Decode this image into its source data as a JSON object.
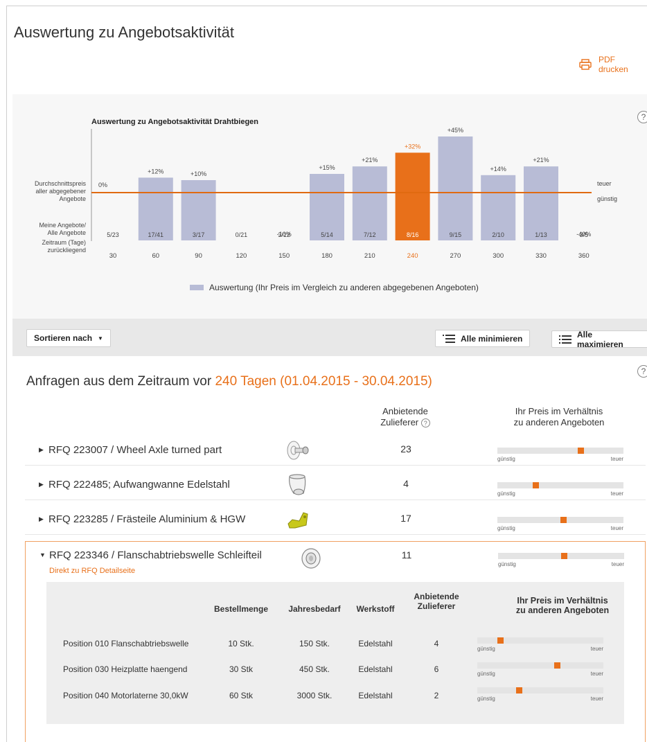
{
  "page": {
    "title": "Auswertung zu Angebotsaktivität",
    "pdf_label": "PDF drucken"
  },
  "chart_help": "?",
  "chart_data": {
    "type": "bar",
    "title": "Auswertung zu Angebotsaktivität Drahtbiegen",
    "categories": [
      "30",
      "60",
      "90",
      "120",
      "150",
      "180",
      "210",
      "240",
      "270",
      "300",
      "330",
      "360"
    ],
    "series": [
      {
        "name": "Auswertung (Ihr Preis im Vergleich zu anderen abgegebenen Angeboten)",
        "values": [
          0,
          12,
          10,
          null,
          -10,
          15,
          21,
          32,
          45,
          14,
          21,
          -40
        ]
      }
    ],
    "value_labels": [
      "0%",
      "+12%",
      "+10%",
      "",
      "-10%",
      "+15%",
      "+21%",
      "+32%",
      "+45%",
      "+14%",
      "+21%",
      "-40%"
    ],
    "offer_ratios": [
      "5/23",
      "17/41",
      "3/17",
      "0/21",
      "3/12",
      "5/14",
      "7/12",
      "8/16",
      "9/15",
      "2/10",
      "1/13",
      "3/5"
    ],
    "highlight_index": 7,
    "reference_line_label": [
      "Durchschnittspreis",
      "aller abgegebener",
      "Angebote"
    ],
    "ratio_row_label": [
      "Meine Angebote/",
      "Alle Angebote"
    ],
    "x_row_label": [
      "Zeitraum (Tage)",
      "zurückliegend"
    ],
    "right_labels": {
      "top": "teuer",
      "bottom": "günstig"
    },
    "colors": {
      "bar": "#b8bcd6",
      "highlight": "#e8701a",
      "line": "#e06a10"
    },
    "legend_placement": "bottom-center"
  },
  "toolbar": {
    "sort_label": "Sortieren nach",
    "minimize_label": "Alle minimieren",
    "maximize_label": "Alle maximieren"
  },
  "section": {
    "title_prefix": "Anfragen aus dem Zeitraum vor ",
    "title_highlight": "240 Tagen (01.04.2015 - 30.04.2015)",
    "help": "?",
    "col_suppliers_1": "Anbietende",
    "col_suppliers_2": "Zulieferer",
    "col_price_1": "Ihr Preis im Verhältnis",
    "col_price_2": "zu anderen Angeboten"
  },
  "gauge_labels": {
    "low": "günstig",
    "high": "teuer"
  },
  "rfqs": [
    {
      "name": "RFQ 223007 / Wheel Axle turned part",
      "suppliers": "23",
      "price_position": 0.66,
      "icon": "wheel-axle-thumbnail"
    },
    {
      "name": "RFQ 222485; Aufwangwanne Edelstahl",
      "suppliers": "4",
      "price_position": 0.3,
      "icon": "tub-thumbnail"
    },
    {
      "name": "RFQ 223285 / Frästeile Aluminium & HGW",
      "suppliers": "17",
      "price_position": 0.52,
      "icon": "bracket-thumbnail"
    },
    {
      "name": "RFQ 223346 / Flanschabtriebswelle Schleifteil",
      "suppliers": "11",
      "price_position": 0.52,
      "icon": "flange-shaft-thumbnail",
      "detail_link": "Direkt zu RFQ Detailseite"
    }
  ],
  "subtable": {
    "headers": {
      "qty": "Bestellmenge",
      "annual": "Jahresbedarf",
      "material": "Werkstoff",
      "suppliers_1": "Anbietende",
      "suppliers_2": "Zulieferer",
      "price_1": "Ihr Preis im Verhältnis",
      "price_2": "zu anderen Angeboten"
    },
    "rows": [
      {
        "position": "Position 010 Flanschabtriebswelle",
        "qty": "10 Stk.",
        "annual": "150 Stk.",
        "material": "Edelstahl",
        "suppliers": "4",
        "price_position": 0.18
      },
      {
        "position": "Position 030 Heizplatte haengend",
        "qty": "30 Stk",
        "annual": "450 Stk.",
        "material": "Edelstahl",
        "suppliers": "6",
        "price_position": 0.63
      },
      {
        "position": "Position 040 Motorlaterne 30,0kW",
        "qty": "60 Stk",
        "annual": "3000 Stk.",
        "material": "Edelstahl",
        "suppliers": "2",
        "price_position": 0.33
      }
    ]
  }
}
